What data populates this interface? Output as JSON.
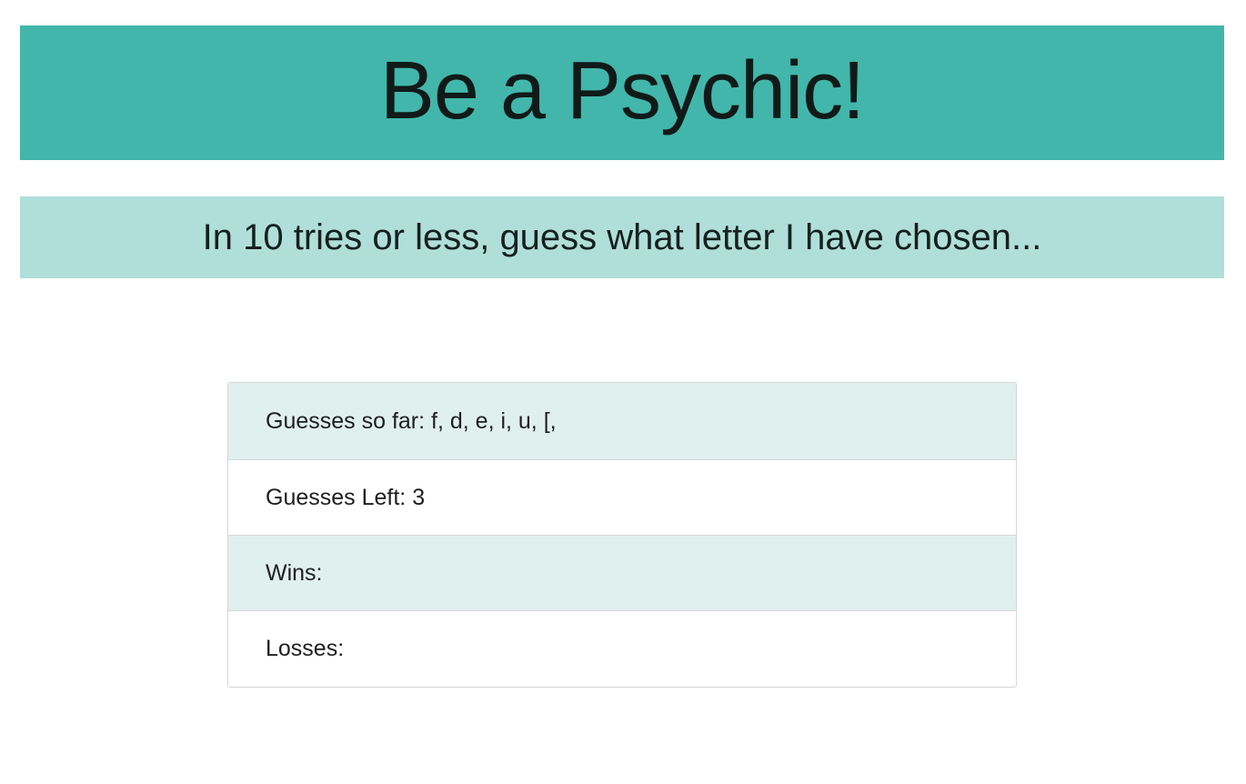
{
  "header": {
    "title": "Be a Psychic!",
    "subtitle": "In 10 tries or less, guess what letter I have chosen..."
  },
  "stats": {
    "guesses_so_far_label": "Guesses so far: ",
    "guesses_so_far_value": "f, d, e, i, u, [,",
    "guesses_left_label": "Guesses Left: ",
    "guesses_left_value": "3",
    "wins_label": "Wins: ",
    "wins_value": "",
    "losses_label": "Losses: ",
    "losses_value": ""
  },
  "colors": {
    "title_bg": "#43b6ab",
    "subtitle_bg": "#b0dfd9",
    "row_tint": "#dff0ef"
  }
}
